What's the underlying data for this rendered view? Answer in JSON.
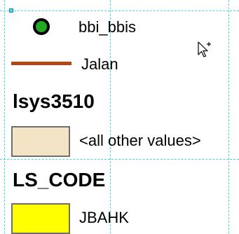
{
  "legend": {
    "items": [
      {
        "label": "bbi_bbis",
        "icon": "circle-point-icon",
        "fill": "#22aa22",
        "stroke": "#000000"
      },
      {
        "label": "Jalan",
        "icon": "line-icon",
        "stroke": "#b04a12"
      }
    ],
    "layer_1": {
      "title": "lsys3510",
      "class_label": "<all other values>",
      "fill": "#f2e4c4",
      "stroke": "#6f6f6f"
    },
    "layer_2": {
      "title": "LS_CODE",
      "class_label": "JBAHK",
      "fill": "#ffff00",
      "stroke": "#6f6f6f"
    }
  },
  "colors": {
    "guide_line": "#4fd3e6",
    "selection_handle": "#4fd3e6"
  },
  "cursor": {
    "icon": "move-add-cursor-icon"
  }
}
